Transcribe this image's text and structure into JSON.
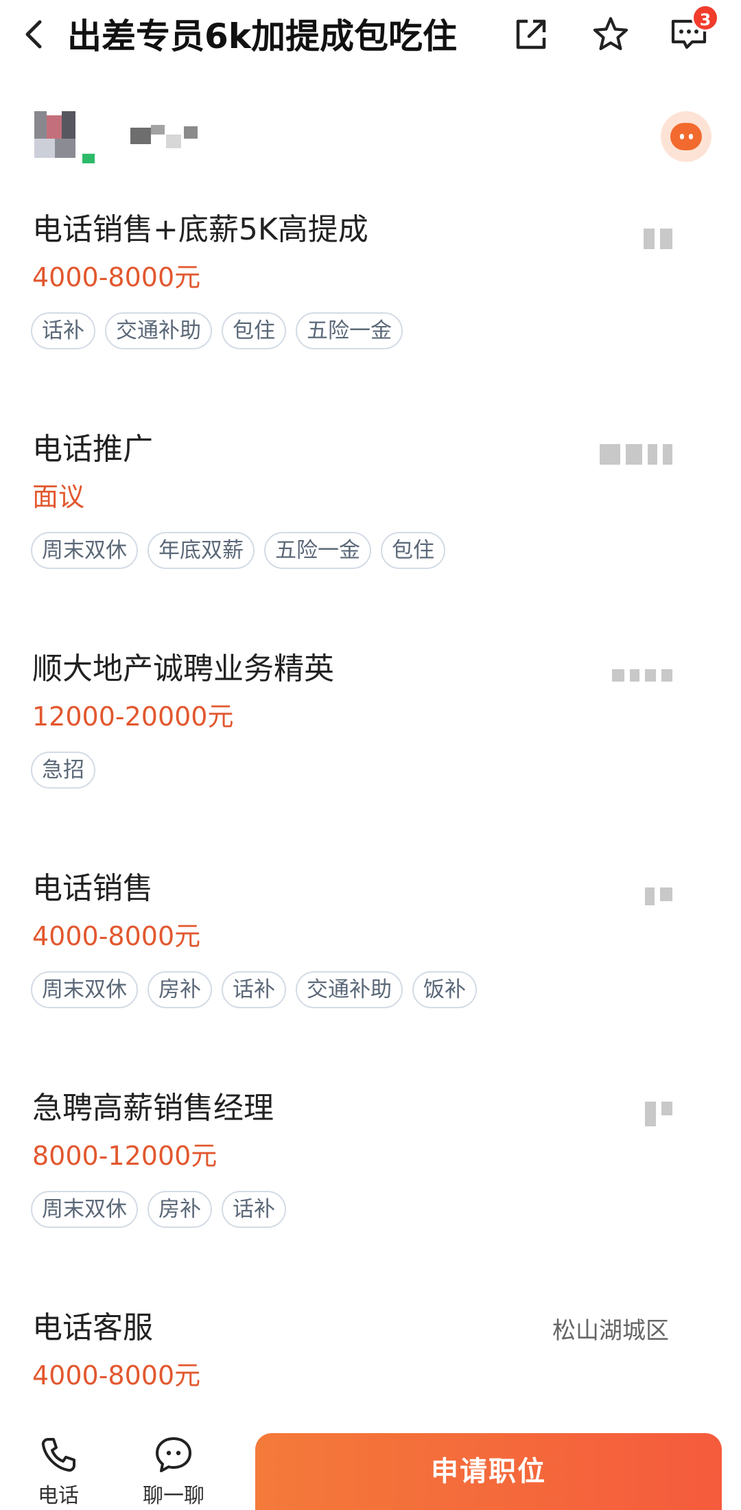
{
  "header": {
    "title": "出差专员6k加提成包吃住",
    "message_badge": "3"
  },
  "company": {
    "logo": "blurred-logo",
    "name": "blurred-name"
  },
  "jobs": [
    {
      "title": "电话销售+底薪5K高提成",
      "salary": "4000-8000元",
      "tags": [
        "话补",
        "交通补助",
        "包住",
        "五险一金"
      ],
      "location": ""
    },
    {
      "title": "电话推广",
      "salary": "面议",
      "tags": [
        "周末双休",
        "年底双薪",
        "五险一金",
        "包住"
      ],
      "location": ""
    },
    {
      "title": "顺大地产诚聘业务精英",
      "salary": "12000-20000元",
      "tags": [
        "急招"
      ],
      "location": ""
    },
    {
      "title": "电话销售",
      "salary": "4000-8000元",
      "tags": [
        "周末双休",
        "房补",
        "话补",
        "交通补助",
        "饭补"
      ],
      "location": ""
    },
    {
      "title": "急聘高薪销售经理",
      "salary": "8000-12000元",
      "tags": [
        "周末双休",
        "房补",
        "话补"
      ],
      "location": ""
    },
    {
      "title": "电话客服",
      "salary": "4000-8000元",
      "tags": [],
      "location": "松山湖城区"
    }
  ],
  "bottom_bar": {
    "phone_label": "电话",
    "chat_label": "聊一聊",
    "apply_label": "申请职位"
  },
  "colors": {
    "salary": "#e2582f",
    "accent": "#f55b3c",
    "badge": "#f23c2b"
  }
}
